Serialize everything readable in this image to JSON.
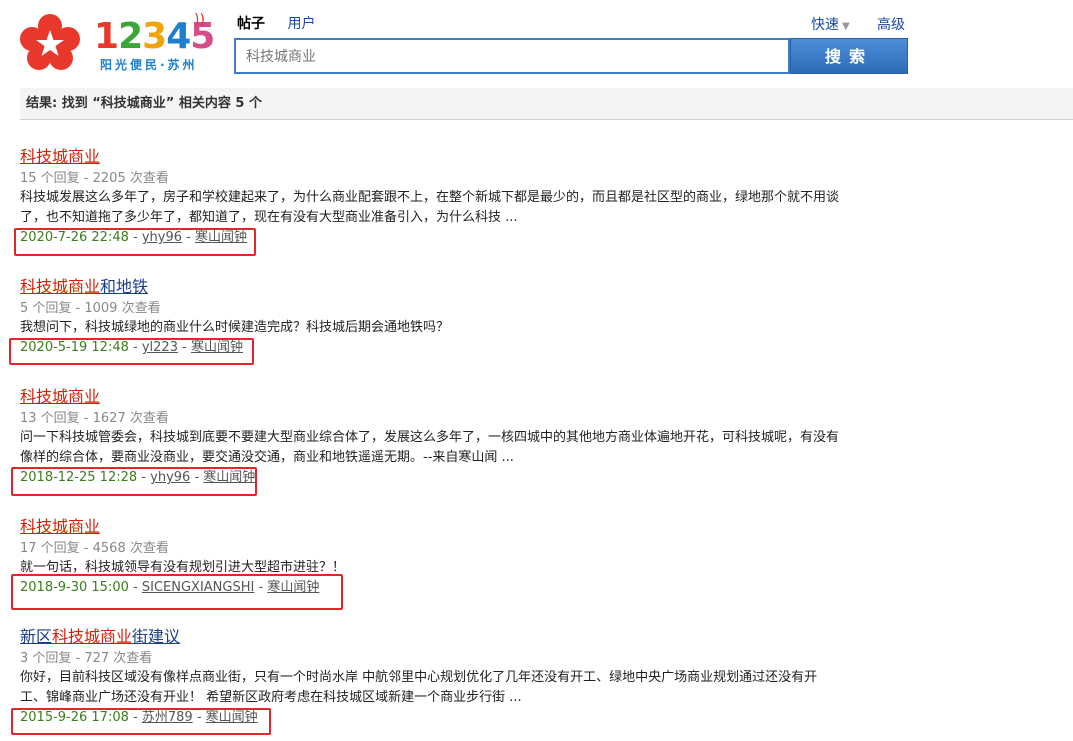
{
  "header": {
    "logo_digits": [
      "1",
      "2",
      "3",
      "4",
      "5"
    ],
    "logo_slogan": "阳光便民·苏州",
    "tabs": [
      {
        "label": "帖子",
        "active": true
      },
      {
        "label": "用户",
        "active": false
      }
    ],
    "search_value": "科技城商业",
    "search_button": "搜索",
    "quick_label": "快速",
    "advanced_label": "高级"
  },
  "result_summary": "结果: 找到 “科技城商业” 相关内容 5 个",
  "results": [
    {
      "title_parts": [
        {
          "text": "科技城商业",
          "hl": true
        }
      ],
      "replies": "15 个回复 - 2205 次查看",
      "snippet": [
        "科技城发展这么多年了，房子和学校建起来了，为什么商业配套跟不上，在整个新城下都是最少的，而且都是社区型的商业，绿地那个就不用谈",
        "了，也不知道拖了多少年了，都知道了，现在有没有大型商业准备引入，为什么科技 ..."
      ],
      "date": "2020-7-26 22:48",
      "author": "yhy96",
      "forum": "寒山闻钟"
    },
    {
      "title_parts": [
        {
          "text": "科技城商业",
          "hl": true
        },
        {
          "text": "和地铁",
          "hl": false
        }
      ],
      "replies": "5 个回复 - 1009 次查看",
      "snippet": [
        "我想问下，科技城绿地的商业什么时候建造完成？科技城后期会通地铁吗？"
      ],
      "date": "2020-5-19 12:48",
      "author": "yl223",
      "forum": "寒山闻钟"
    },
    {
      "title_parts": [
        {
          "text": "科技城商业",
          "hl": true
        }
      ],
      "replies": "13 个回复 - 1627 次查看",
      "snippet": [
        "问一下科技城管委会，科技城到底要不要建大型商业综合体了，发展这么多年了，一核四城中的其他地方商业体遍地开花，可科技城呢，有没有",
        "像样的综合体，要商业没商业，要交通没交通，商业和地铁遥遥无期。--来自寒山闻 ..."
      ],
      "date": "2018-12-25 12:28",
      "author": "yhy96",
      "forum": "寒山闻钟"
    },
    {
      "title_parts": [
        {
          "text": "科技城商业",
          "hl": true
        }
      ],
      "replies": "17 个回复 - 4568 次查看",
      "snippet": [
        "就一句话，科技城领导有没有规划引进大型超市进驻？！"
      ],
      "date": "2018-9-30 15:00",
      "author": "SICENGXIANGSHI",
      "forum": "寒山闻钟"
    },
    {
      "title_parts": [
        {
          "text": "新区",
          "hl": false
        },
        {
          "text": "科技城商业",
          "hl": true
        },
        {
          "text": "街建议",
          "hl": false
        }
      ],
      "replies": "3 个回复 - 727 次查看",
      "snippet": [
        "你好，目前科技区域没有像样点商业街，只有一个时尚水岸 中航邻里中心规划优化了几年还没有开工、绿地中央广场商业规划通过还没有开",
        "工、锦峰商业广场还没有开业！ 希望新区政府考虑在科技城区域新建一个商业步行街 ..."
      ],
      "date": "2015-9-26 17:08",
      "author": "苏州789",
      "forum": "寒山闻钟"
    }
  ]
}
